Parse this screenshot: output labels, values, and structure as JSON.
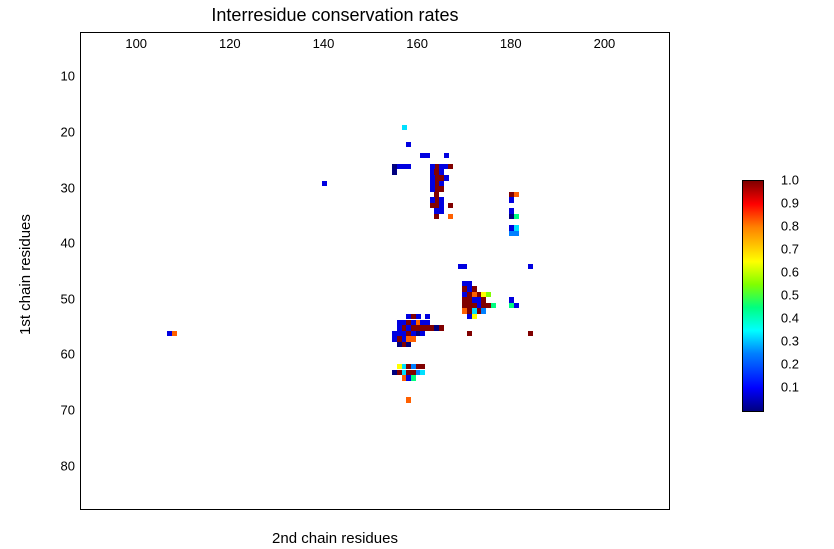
{
  "chart_data": {
    "type": "heatmap",
    "title": "Interresidue conservation rates",
    "xlabel": "2nd chain residues",
    "ylabel": "1st chain residues",
    "xlim": [
      88,
      214
    ],
    "ylim": [
      88,
      2
    ],
    "xticks": [
      100,
      120,
      140,
      160,
      180,
      200
    ],
    "yticks": [
      10,
      20,
      30,
      40,
      50,
      60,
      70,
      80
    ],
    "colorbar_ticks": [
      0.1,
      0.2,
      0.3,
      0.4,
      0.5,
      0.6,
      0.7,
      0.8,
      0.9,
      1.0
    ],
    "points": [
      {
        "x": 107,
        "y": 56,
        "v": 0.1
      },
      {
        "x": 108,
        "y": 56,
        "v": 0.8
      },
      {
        "x": 140,
        "y": 29,
        "v": 0.1
      },
      {
        "x": 155,
        "y": 26,
        "v": 0.05
      },
      {
        "x": 156,
        "y": 26,
        "v": 0.1
      },
      {
        "x": 157,
        "y": 26,
        "v": 0.1
      },
      {
        "x": 158,
        "y": 26,
        "v": 0.1
      },
      {
        "x": 155,
        "y": 27,
        "v": 0.05
      },
      {
        "x": 156,
        "y": 54,
        "v": 0.1
      },
      {
        "x": 156,
        "y": 55,
        "v": 0.1
      },
      {
        "x": 156,
        "y": 56,
        "v": 0.1
      },
      {
        "x": 156,
        "y": 57,
        "v": 1.0
      },
      {
        "x": 156,
        "y": 58,
        "v": 0.05
      },
      {
        "x": 155,
        "y": 57,
        "v": 0.1
      },
      {
        "x": 155,
        "y": 56,
        "v": 0.1
      },
      {
        "x": 156,
        "y": 62,
        "v": 0.6
      },
      {
        "x": 156,
        "y": 63,
        "v": 1.0
      },
      {
        "x": 155,
        "y": 63,
        "v": 0.05
      },
      {
        "x": 157,
        "y": 19,
        "v": 0.3
      },
      {
        "x": 158,
        "y": 22,
        "v": 0.1
      },
      {
        "x": 157,
        "y": 54,
        "v": 0.1
      },
      {
        "x": 157,
        "y": 55,
        "v": 1.0
      },
      {
        "x": 157,
        "y": 56,
        "v": 0.1
      },
      {
        "x": 157,
        "y": 57,
        "v": 0.1
      },
      {
        "x": 157,
        "y": 58,
        "v": 1.0
      },
      {
        "x": 158,
        "y": 53,
        "v": 0.1
      },
      {
        "x": 158,
        "y": 54,
        "v": 1.0
      },
      {
        "x": 158,
        "y": 55,
        "v": 0.1
      },
      {
        "x": 158,
        "y": 56,
        "v": 1.0
      },
      {
        "x": 158,
        "y": 57,
        "v": 0.8
      },
      {
        "x": 158,
        "y": 58,
        "v": 0.05
      },
      {
        "x": 157,
        "y": 62,
        "v": 0.3
      },
      {
        "x": 157,
        "y": 63,
        "v": 0.3
      },
      {
        "x": 157,
        "y": 64,
        "v": 0.8
      },
      {
        "x": 158,
        "y": 62,
        "v": 1.0
      },
      {
        "x": 158,
        "y": 63,
        "v": 1.0
      },
      {
        "x": 158,
        "y": 64,
        "v": 0.1
      },
      {
        "x": 158,
        "y": 68,
        "v": 0.8
      },
      {
        "x": 159,
        "y": 53,
        "v": 1.0
      },
      {
        "x": 159,
        "y": 54,
        "v": 0.1
      },
      {
        "x": 159,
        "y": 55,
        "v": 1.0
      },
      {
        "x": 159,
        "y": 56,
        "v": 0.1
      },
      {
        "x": 159,
        "y": 57,
        "v": 0.8
      },
      {
        "x": 160,
        "y": 53,
        "v": 0.1
      },
      {
        "x": 160,
        "y": 54,
        "v": 0.8
      },
      {
        "x": 160,
        "y": 55,
        "v": 1.0
      },
      {
        "x": 160,
        "y": 56,
        "v": 0.05
      },
      {
        "x": 159,
        "y": 62,
        "v": 0.2
      },
      {
        "x": 159,
        "y": 63,
        "v": 1.0
      },
      {
        "x": 159,
        "y": 64,
        "v": 0.4
      },
      {
        "x": 160,
        "y": 63,
        "v": 0.2
      },
      {
        "x": 160,
        "y": 62,
        "v": 1.0
      },
      {
        "x": 161,
        "y": 24,
        "v": 0.1
      },
      {
        "x": 162,
        "y": 24,
        "v": 0.1
      },
      {
        "x": 163,
        "y": 27,
        "v": 0.1
      },
      {
        "x": 161,
        "y": 54,
        "v": 0.1
      },
      {
        "x": 161,
        "y": 55,
        "v": 1.0
      },
      {
        "x": 161,
        "y": 56,
        "v": 0.1
      },
      {
        "x": 162,
        "y": 53,
        "v": 0.1
      },
      {
        "x": 162,
        "y": 54,
        "v": 0.1
      },
      {
        "x": 162,
        "y": 55,
        "v": 1.0
      },
      {
        "x": 161,
        "y": 62,
        "v": 1.0
      },
      {
        "x": 161,
        "y": 63,
        "v": 0.3
      },
      {
        "x": 163,
        "y": 55,
        "v": 1.0
      },
      {
        "x": 164,
        "y": 55,
        "v": 0.05
      },
      {
        "x": 165,
        "y": 55,
        "v": 1.0
      },
      {
        "x": 164,
        "y": 26,
        "v": 1.0
      },
      {
        "x": 164,
        "y": 27,
        "v": 1.0
      },
      {
        "x": 164,
        "y": 28,
        "v": 1.0
      },
      {
        "x": 164,
        "y": 29,
        "v": 1.0
      },
      {
        "x": 164,
        "y": 30,
        "v": 1.0
      },
      {
        "x": 164,
        "y": 31,
        "v": 1.0
      },
      {
        "x": 164,
        "y": 32,
        "v": 1.0
      },
      {
        "x": 164,
        "y": 33,
        "v": 1.0
      },
      {
        "x": 164,
        "y": 34,
        "v": 0.1
      },
      {
        "x": 164,
        "y": 35,
        "v": 1.0
      },
      {
        "x": 163,
        "y": 26,
        "v": 0.1
      },
      {
        "x": 163,
        "y": 28,
        "v": 0.1
      },
      {
        "x": 163,
        "y": 29,
        "v": 0.1
      },
      {
        "x": 163,
        "y": 30,
        "v": 0.1
      },
      {
        "x": 163,
        "y": 32,
        "v": 0.1
      },
      {
        "x": 163,
        "y": 33,
        "v": 1.0
      },
      {
        "x": 165,
        "y": 26,
        "v": 0.1
      },
      {
        "x": 165,
        "y": 27,
        "v": 0.1
      },
      {
        "x": 165,
        "y": 28,
        "v": 1.0
      },
      {
        "x": 165,
        "y": 29,
        "v": 0.1
      },
      {
        "x": 165,
        "y": 30,
        "v": 1.0
      },
      {
        "x": 165,
        "y": 32,
        "v": 0.1
      },
      {
        "x": 165,
        "y": 33,
        "v": 0.1
      },
      {
        "x": 165,
        "y": 34,
        "v": 0.1
      },
      {
        "x": 166,
        "y": 26,
        "v": 0.1
      },
      {
        "x": 166,
        "y": 28,
        "v": 0.1
      },
      {
        "x": 166,
        "y": 24,
        "v": 0.1
      },
      {
        "x": 167,
        "y": 26,
        "v": 1.0
      },
      {
        "x": 167,
        "y": 33,
        "v": 1.0
      },
      {
        "x": 167,
        "y": 35,
        "v": 0.8
      },
      {
        "x": 169,
        "y": 44,
        "v": 0.1
      },
      {
        "x": 170,
        "y": 44,
        "v": 0.1
      },
      {
        "x": 170,
        "y": 47,
        "v": 0.1
      },
      {
        "x": 170,
        "y": 48,
        "v": 1.0
      },
      {
        "x": 170,
        "y": 49,
        "v": 0.1
      },
      {
        "x": 170,
        "y": 50,
        "v": 1.0
      },
      {
        "x": 170,
        "y": 51,
        "v": 1.0
      },
      {
        "x": 170,
        "y": 52,
        "v": 0.8
      },
      {
        "x": 171,
        "y": 47,
        "v": 0.1
      },
      {
        "x": 171,
        "y": 48,
        "v": 0.1
      },
      {
        "x": 171,
        "y": 49,
        "v": 1.0
      },
      {
        "x": 171,
        "y": 50,
        "v": 1.0
      },
      {
        "x": 171,
        "y": 51,
        "v": 1.0
      },
      {
        "x": 171,
        "y": 52,
        "v": 1.0
      },
      {
        "x": 171,
        "y": 53,
        "v": 0.1
      },
      {
        "x": 171,
        "y": 56,
        "v": 1.0
      },
      {
        "x": 172,
        "y": 48,
        "v": 1.0
      },
      {
        "x": 172,
        "y": 49,
        "v": 0.8
      },
      {
        "x": 172,
        "y": 50,
        "v": 0.1
      },
      {
        "x": 172,
        "y": 51,
        "v": 1.0
      },
      {
        "x": 172,
        "y": 52,
        "v": 0.3
      },
      {
        "x": 172,
        "y": 53,
        "v": 0.6
      },
      {
        "x": 173,
        "y": 49,
        "v": 1.0
      },
      {
        "x": 173,
        "y": 50,
        "v": 0.1
      },
      {
        "x": 173,
        "y": 51,
        "v": 0.1
      },
      {
        "x": 173,
        "y": 52,
        "v": 1.0
      },
      {
        "x": 174,
        "y": 49,
        "v": 0.6
      },
      {
        "x": 174,
        "y": 50,
        "v": 1.0
      },
      {
        "x": 174,
        "y": 51,
        "v": 1.0
      },
      {
        "x": 174,
        "y": 52,
        "v": 0.2
      },
      {
        "x": 175,
        "y": 49,
        "v": 0.5
      },
      {
        "x": 175,
        "y": 51,
        "v": 1.0
      },
      {
        "x": 176,
        "y": 51,
        "v": 0.4
      },
      {
        "x": 180,
        "y": 31,
        "v": 1.0
      },
      {
        "x": 180,
        "y": 32,
        "v": 0.1
      },
      {
        "x": 181,
        "y": 31,
        "v": 0.8
      },
      {
        "x": 180,
        "y": 34,
        "v": 0.1
      },
      {
        "x": 180,
        "y": 35,
        "v": 0.05
      },
      {
        "x": 181,
        "y": 35,
        "v": 0.4
      },
      {
        "x": 180,
        "y": 37,
        "v": 0.1
      },
      {
        "x": 180,
        "y": 38,
        "v": 0.2
      },
      {
        "x": 181,
        "y": 37,
        "v": 0.3
      },
      {
        "x": 181,
        "y": 38,
        "v": 0.2
      },
      {
        "x": 180,
        "y": 50,
        "v": 0.1
      },
      {
        "x": 180,
        "y": 51,
        "v": 0.4
      },
      {
        "x": 181,
        "y": 51,
        "v": 0.1
      },
      {
        "x": 184,
        "y": 44,
        "v": 0.1
      },
      {
        "x": 184,
        "y": 56,
        "v": 1.0
      }
    ]
  }
}
